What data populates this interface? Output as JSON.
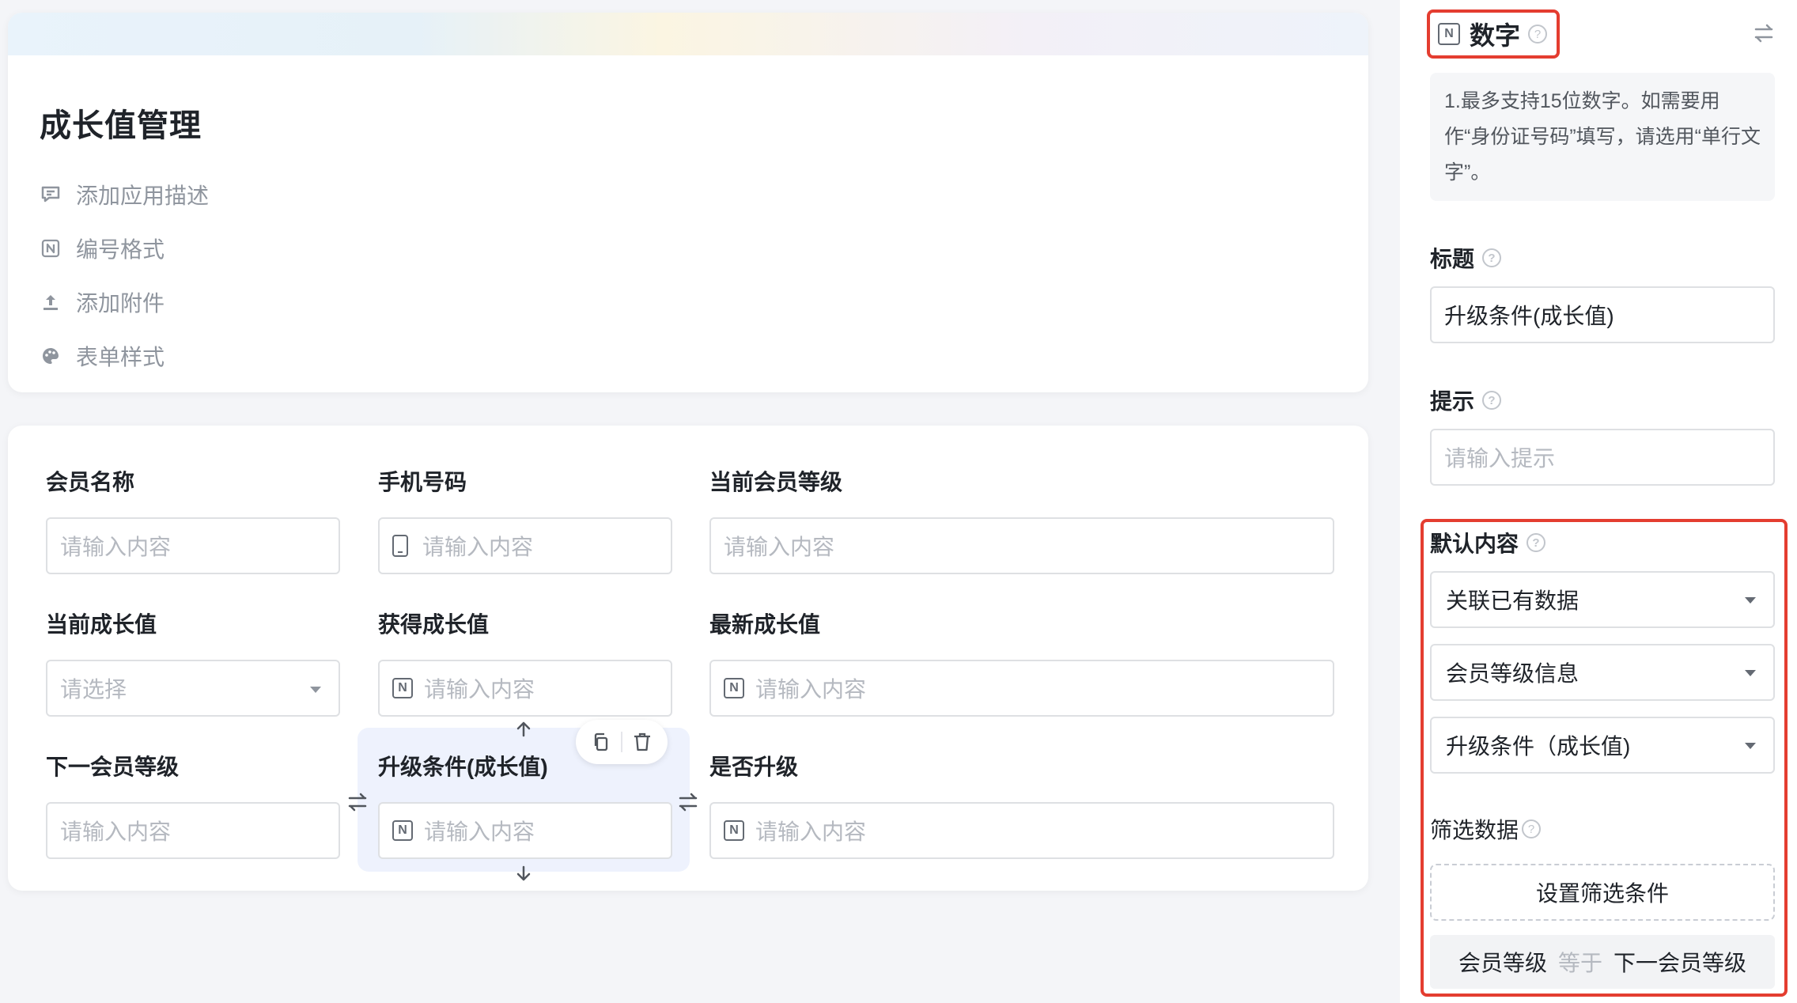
{
  "app": {
    "title": "成长值管理",
    "meta_items": [
      {
        "icon": "comment-icon",
        "label": "添加应用描述"
      },
      {
        "icon": "number-format-icon",
        "label": "编号格式"
      },
      {
        "icon": "upload-icon",
        "label": "添加附件"
      },
      {
        "icon": "palette-icon",
        "label": "表单样式"
      }
    ]
  },
  "form": {
    "fields": [
      {
        "label": "会员名称",
        "placeholder": "请输入内容"
      },
      {
        "label": "手机号码",
        "placeholder": "请输入内容"
      },
      {
        "label": "当前会员等级",
        "placeholder": "请输入内容"
      },
      {
        "label": "当前成长值",
        "placeholder": "请选择"
      },
      {
        "label": "获得成长值",
        "placeholder": "请输入内容"
      },
      {
        "label": "最新成长值",
        "placeholder": "请输入内容"
      },
      {
        "label": "下一会员等级",
        "placeholder": "请输入内容"
      },
      {
        "label": "升级条件(成长值)",
        "placeholder": "请输入内容"
      },
      {
        "label": "是否升级",
        "placeholder": "请输入内容"
      }
    ]
  },
  "panel": {
    "field_type": "数字",
    "type_icon": "N",
    "description": "1.最多支持15位数字。如需要用作“身份证号码”填写，请选用“单行文字”。",
    "title_label": "标题",
    "title_value": "升级条件(成长值)",
    "hint_label": "提示",
    "hint_placeholder": "请输入提示",
    "default_label": "默认内容",
    "default_mode": "关联已有数据",
    "source_form": "会员等级信息",
    "source_field": "升级条件（成长值)",
    "filter_label": "筛选数据",
    "filter_button": "设置筛选条件",
    "filter_condition": {
      "left": "会员等级",
      "op": "等于",
      "right": "下一会员等级"
    }
  },
  "colors": {
    "highlight_border": "#e43d30",
    "selected_bg": "#eef2fd",
    "placeholder": "#b5b9c0"
  }
}
